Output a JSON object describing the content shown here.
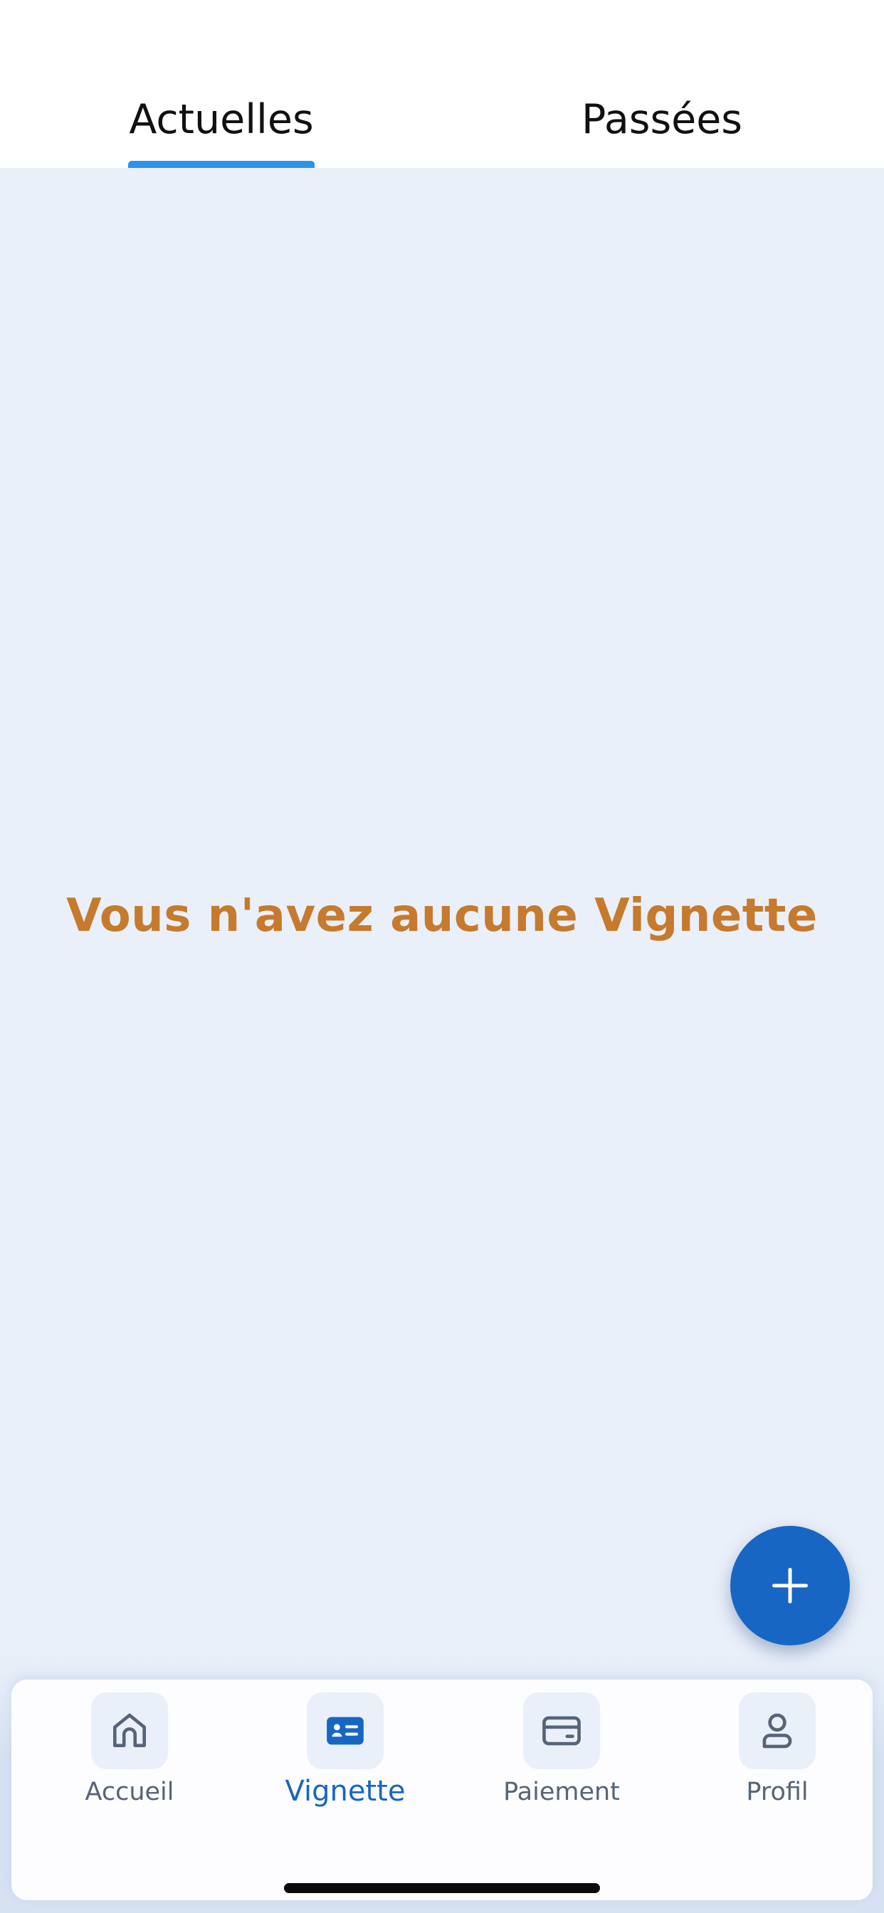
{
  "tabs": {
    "current_label": "Actuelles",
    "past_label": "Passées",
    "active": "current"
  },
  "empty_state": {
    "message": "Vous n'avez aucune Vignette"
  },
  "fab": {
    "icon": "plus-icon"
  },
  "bottom_nav": {
    "active": "vignette",
    "items": [
      {
        "id": "accueil",
        "label": "Accueil",
        "icon": "home-icon"
      },
      {
        "id": "vignette",
        "label": "Vignette",
        "icon": "id-card-icon"
      },
      {
        "id": "paiement",
        "label": "Paiement",
        "icon": "credit-card-icon"
      },
      {
        "id": "profil",
        "label": "Profil",
        "icon": "user-icon"
      }
    ]
  },
  "colors": {
    "primary": "#1766c3",
    "tab_indicator": "#2c93e8",
    "empty_message": "#c67a2d",
    "background": "#eaf0f9",
    "inactive_nav": "#566478"
  }
}
